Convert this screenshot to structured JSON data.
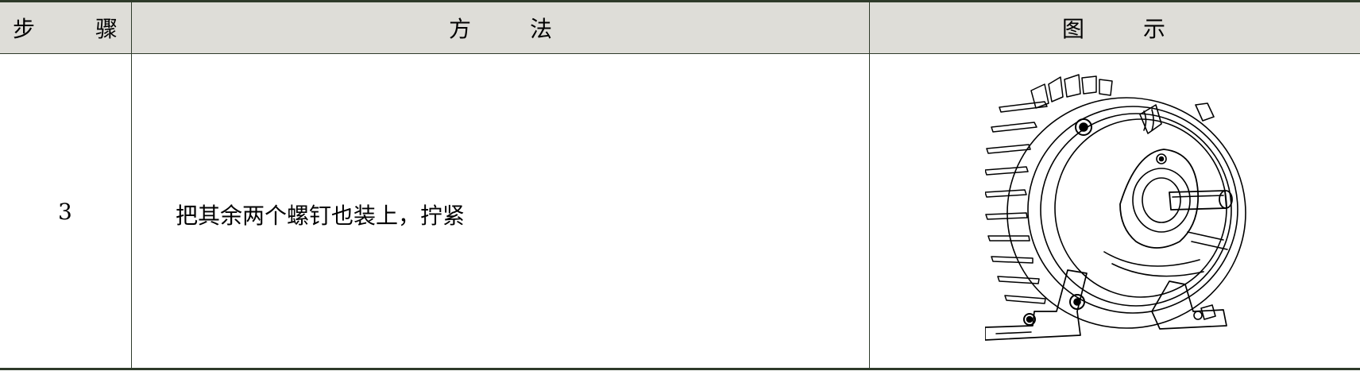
{
  "table": {
    "headers": {
      "step": [
        "步",
        "骤"
      ],
      "method": [
        "方",
        "法"
      ],
      "figure": [
        "图",
        "示"
      ]
    },
    "rows": [
      {
        "step": "3",
        "method": "把其余两个螺钉也装上，拧紧",
        "figure_icon": "motor-end-cover-icon"
      }
    ]
  },
  "colors": {
    "header_bg": "#deddd8",
    "rule": "#2e3a2a"
  }
}
